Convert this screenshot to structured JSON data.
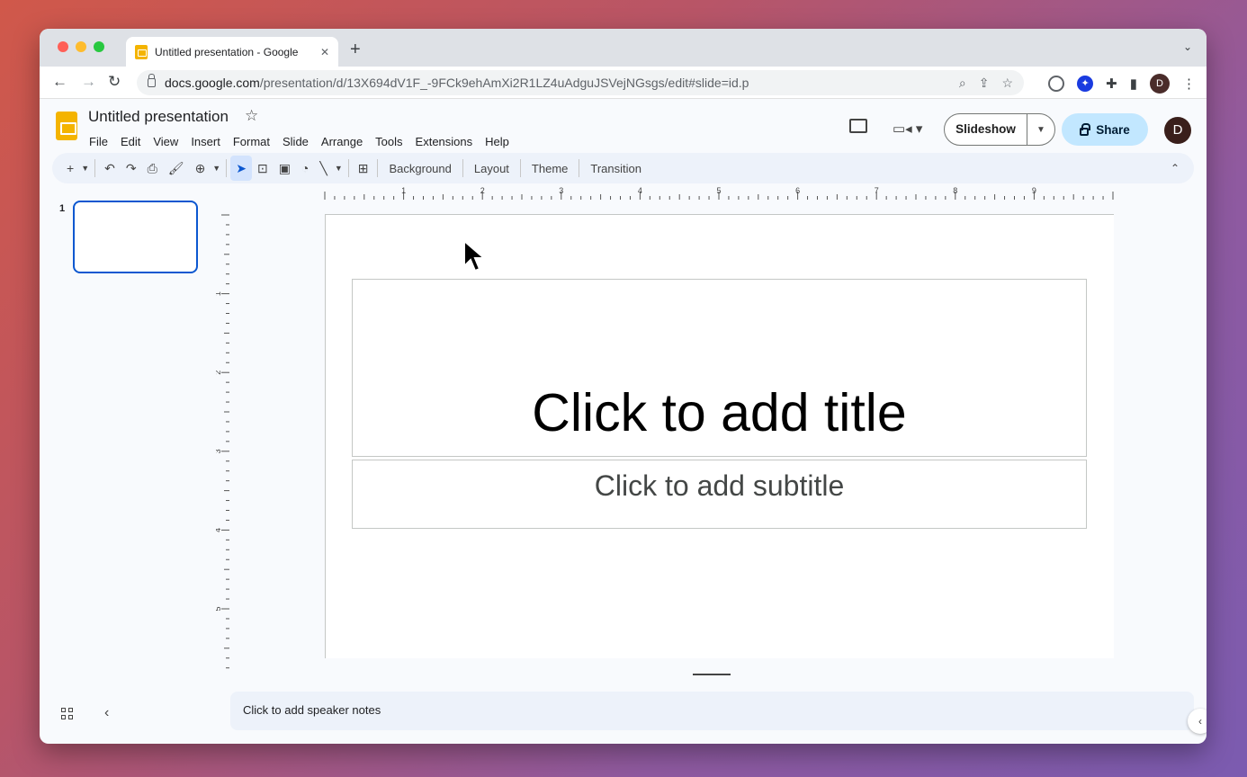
{
  "browser": {
    "tab_title": "Untitled presentation - Google",
    "url_host": "docs.google.com",
    "url_path": "/presentation/d/13X694dV1F_-9FCk9ehAmXi2R1LZ4uAdguJSVejNGsgs/edit#slide=id.p",
    "avatar_letter": "D"
  },
  "doc": {
    "title": "Untitled presentation",
    "menu": [
      "File",
      "Edit",
      "View",
      "Insert",
      "Format",
      "Slide",
      "Arrange",
      "Tools",
      "Extensions",
      "Help"
    ],
    "slideshow_label": "Slideshow",
    "share_label": "Share",
    "avatar_letter": "D"
  },
  "toolbar": {
    "background_label": "Background",
    "layout_label": "Layout",
    "theme_label": "Theme",
    "transition_label": "Transition"
  },
  "filmstrip": {
    "slide_number": "1"
  },
  "ruler": {
    "h_labels": [
      "1",
      "2",
      "3",
      "4",
      "5",
      "6",
      "7",
      "8",
      "9"
    ],
    "v_labels": [
      "1",
      "2",
      "3",
      "4",
      "5"
    ]
  },
  "slide": {
    "title_placeholder": "Click to add title",
    "subtitle_placeholder": "Click to add subtitle"
  },
  "notes": {
    "placeholder": "Click to add speaker notes"
  },
  "colors": {
    "accent": "#0b57d0",
    "share_bg": "#c2e7ff",
    "slides_logo": "#f4b400"
  }
}
